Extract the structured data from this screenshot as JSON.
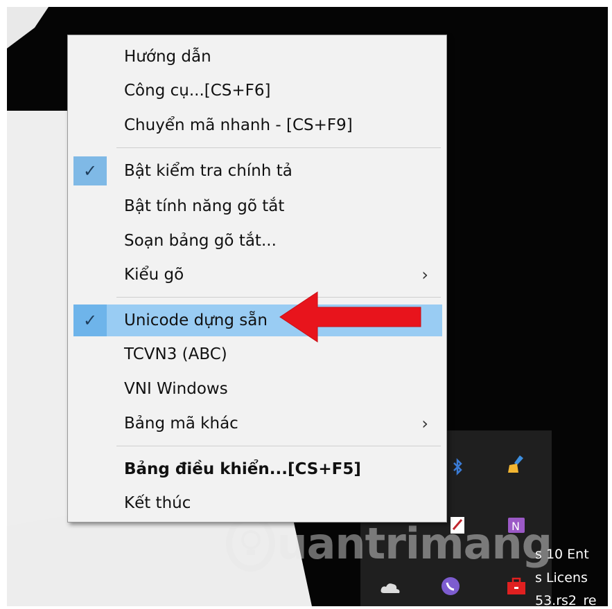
{
  "menu": {
    "items": [
      {
        "label": "Hướng dẫn",
        "checked": false,
        "submenu": false
      },
      {
        "label": "Công cụ...[CS+F6]",
        "checked": false,
        "submenu": false
      },
      {
        "label": "Chuyển mã nhanh - [CS+F9]",
        "checked": false,
        "submenu": false
      },
      {
        "label": "Bật kiểm tra chính tả",
        "checked": true,
        "submenu": false
      },
      {
        "label": "Bật tính năng gõ tắt",
        "checked": false,
        "submenu": false
      },
      {
        "label": "Soạn bảng gõ tắt...",
        "checked": false,
        "submenu": false
      },
      {
        "label": "Kiểu gõ",
        "checked": false,
        "submenu": true
      },
      {
        "label": "Unicode dựng sẵn",
        "checked": true,
        "submenu": false,
        "highlighted": true
      },
      {
        "label": "TCVN3 (ABC)",
        "checked": false,
        "submenu": false
      },
      {
        "label": "VNI Windows",
        "checked": false,
        "submenu": false
      },
      {
        "label": "Bảng mã khác",
        "checked": false,
        "submenu": true
      },
      {
        "label": "Bảng điều khiển...[CS+F5]",
        "checked": false,
        "submenu": false,
        "bold": true
      },
      {
        "label": "Kết thúc",
        "checked": false,
        "submenu": false
      }
    ],
    "check_glyph": "✓",
    "submenu_glyph": "›",
    "highlight_color": "#99ccf3"
  },
  "annotation": {
    "arrow_color": "#e8141c"
  },
  "desktop_text": {
    "line1": "s 10 Ent",
    "line2": "s Licens",
    "line3": "53.rs2_re"
  },
  "watermark": {
    "text": "uantrimang"
  },
  "tray_icons": [
    "bluetooth-icon",
    "cleaner-broom-icon",
    "pdf-icon",
    "onenote-icon",
    "onedrive-cloud-icon",
    "viber-icon",
    "toolbox-icon"
  ]
}
